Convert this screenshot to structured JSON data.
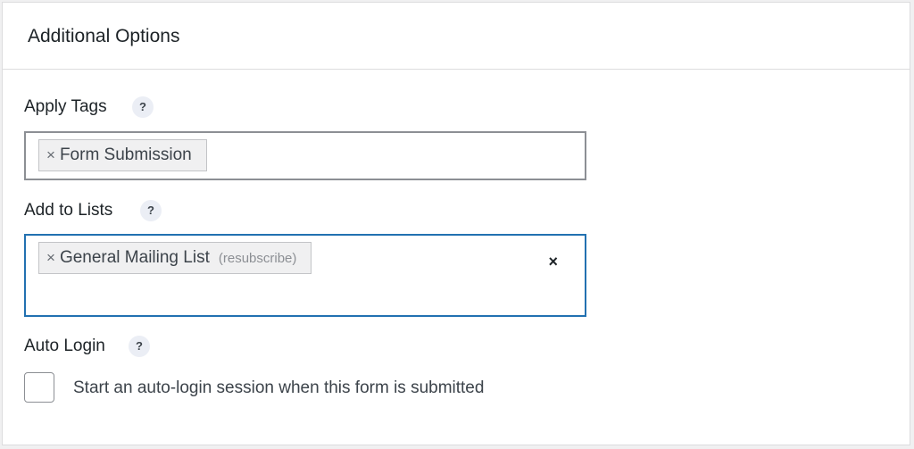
{
  "panel": {
    "title": "Additional Options"
  },
  "apply_tags": {
    "label": "Apply Tags",
    "help": "?",
    "chips": [
      {
        "remove": "×",
        "label": "Form Submission"
      }
    ]
  },
  "add_to_lists": {
    "label": "Add to Lists",
    "help": "?",
    "chips": [
      {
        "remove": "×",
        "label": "General Mailing List",
        "sublabel": "(resubscribe)"
      }
    ],
    "clear": "×"
  },
  "auto_login": {
    "label": "Auto Login",
    "help": "?",
    "checkbox_label": "Start an auto-login session when this form is submitted",
    "checked": false
  }
}
